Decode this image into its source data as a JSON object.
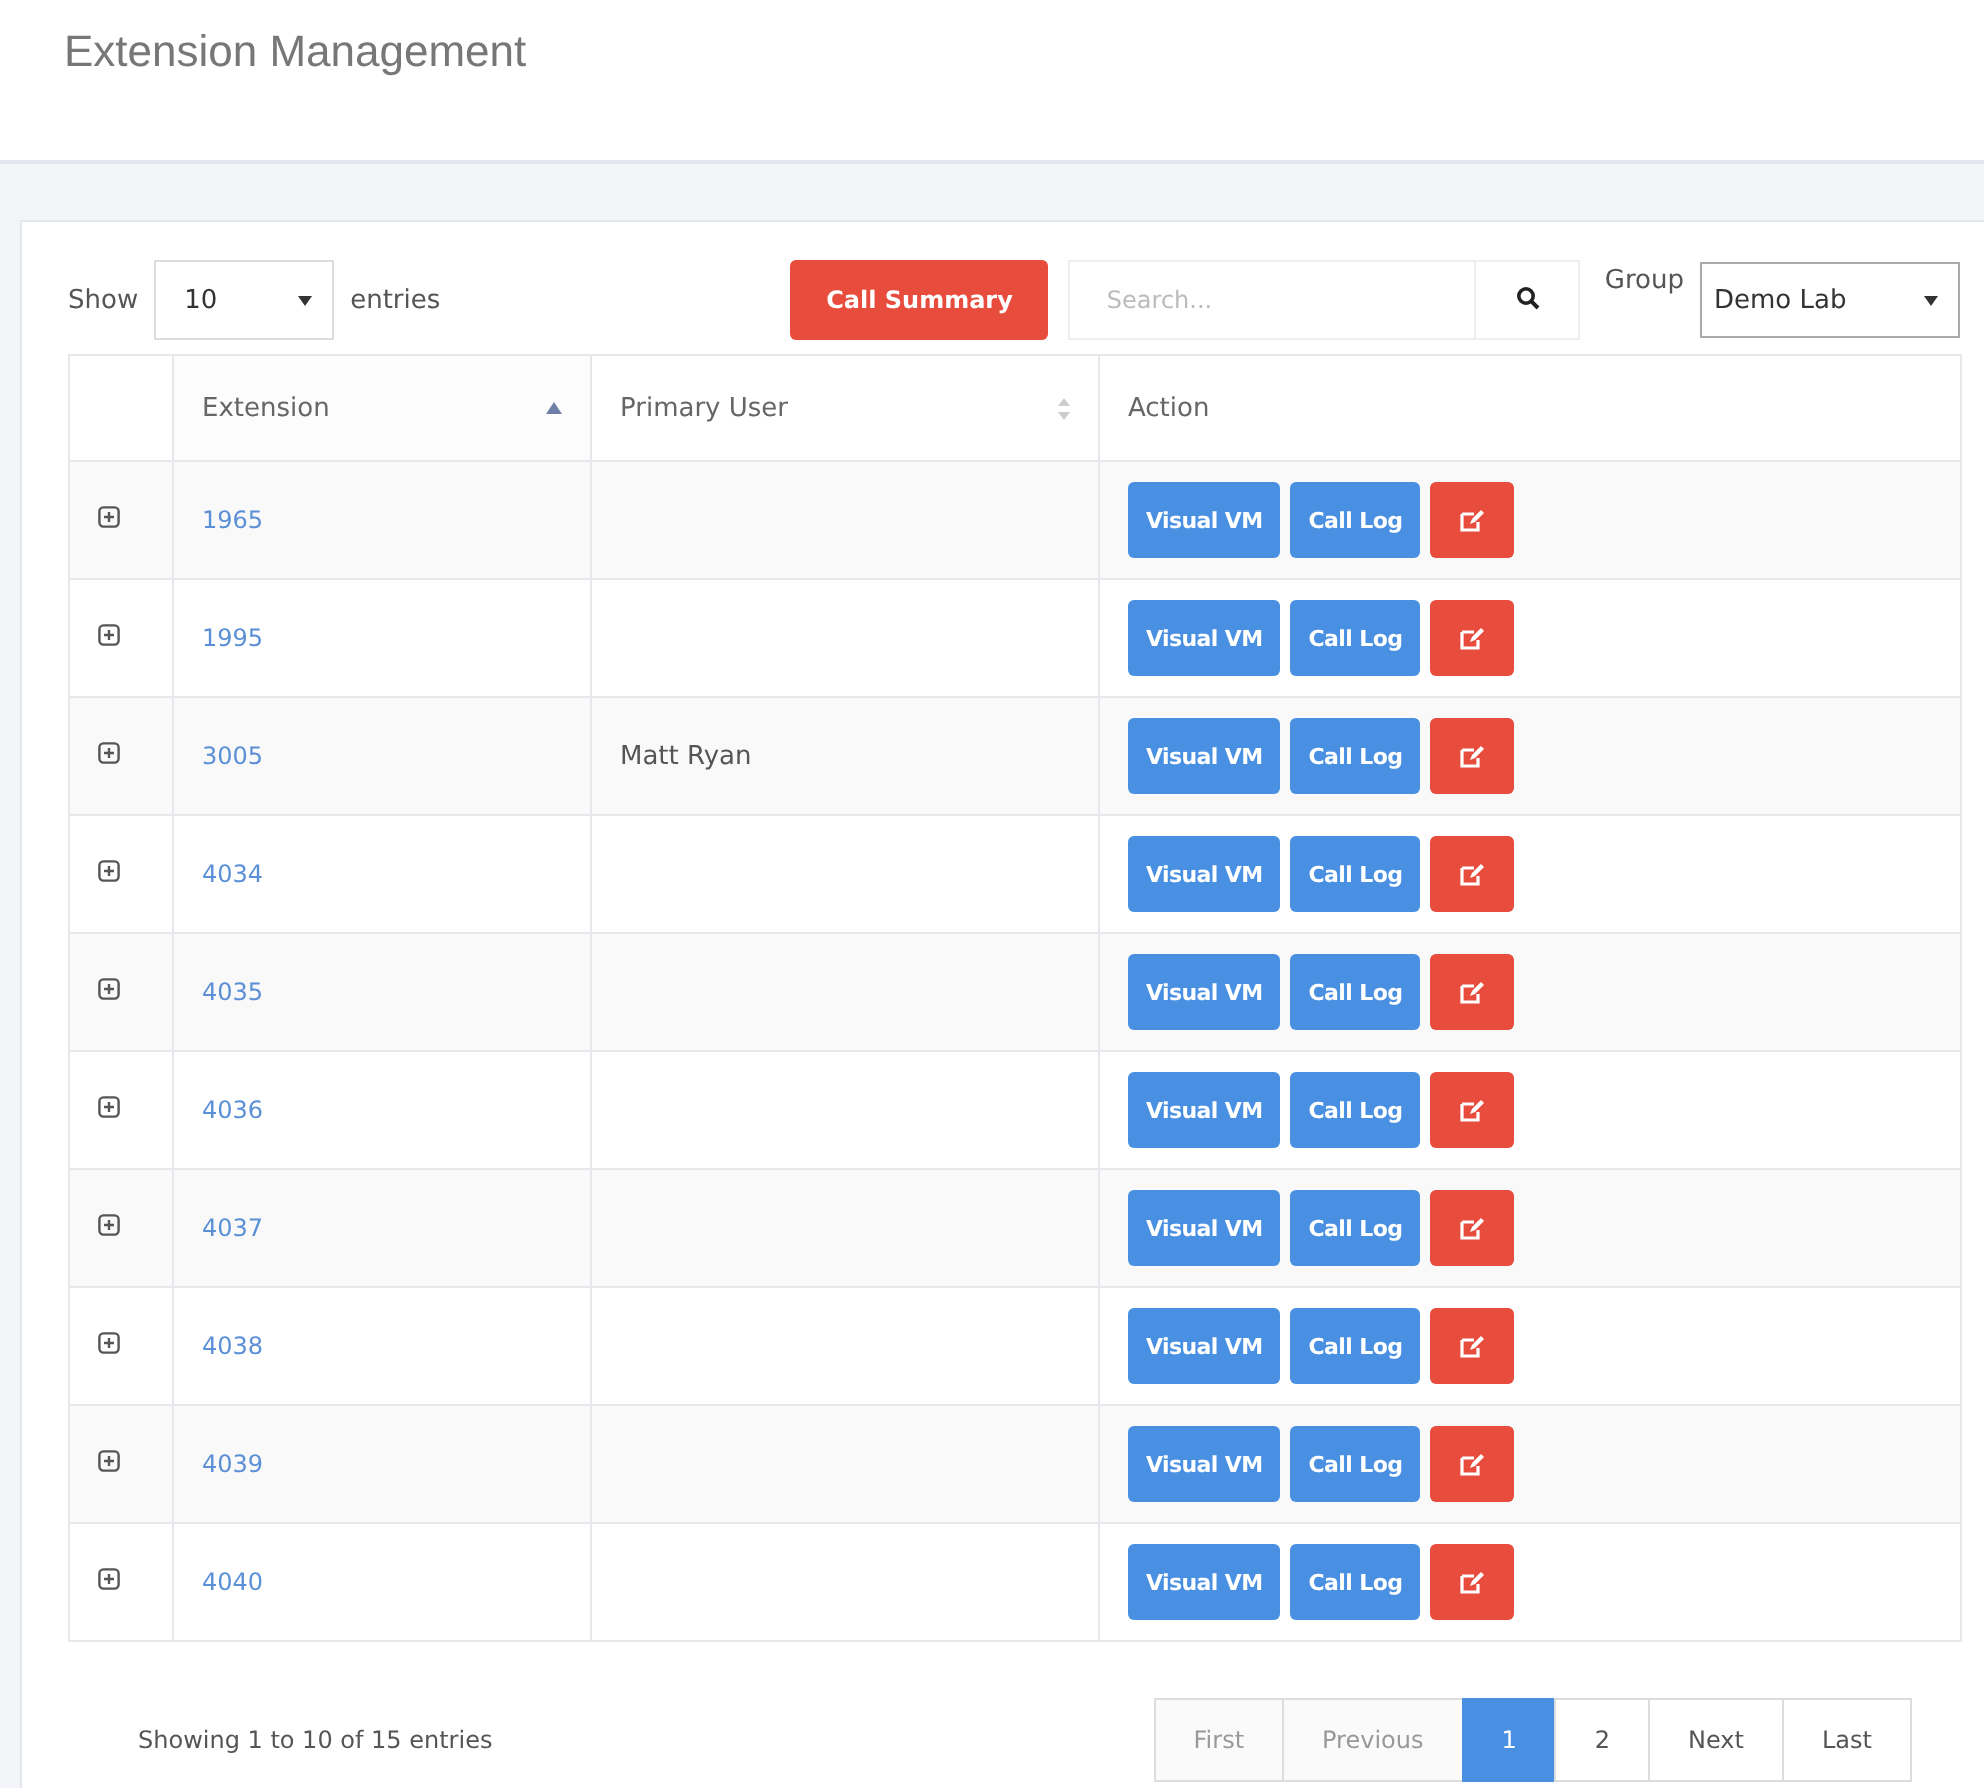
{
  "page": {
    "title": "Extension Management"
  },
  "toolbar": {
    "show_label": "Show",
    "page_size": "10",
    "entries_label": "entries",
    "summary_button": "Call Summary",
    "search": {
      "placeholder": "Search..."
    },
    "group_label": "Group",
    "group_value": "Demo Lab"
  },
  "table": {
    "columns": [
      {},
      {
        "label": "Extension",
        "sorted": true
      },
      {
        "label": "Primary User",
        "sorted": false
      },
      {
        "label": "Action"
      }
    ],
    "rows": [
      {
        "extension": "1965",
        "primary_user": "",
        "actions": [
          "Visual VM",
          "Call Log"
        ]
      },
      {
        "extension": "1995",
        "primary_user": "",
        "actions": [
          "Visual VM",
          "Call Log"
        ]
      },
      {
        "extension": "3005",
        "primary_user": "Matt Ryan",
        "actions": [
          "Visual VM",
          "Call Log"
        ]
      },
      {
        "extension": "4034",
        "primary_user": "",
        "actions": [
          "Visual VM",
          "Call Log"
        ]
      },
      {
        "extension": "4035",
        "primary_user": "",
        "actions": [
          "Visual VM",
          "Call Log"
        ]
      },
      {
        "extension": "4036",
        "primary_user": "",
        "actions": [
          "Visual VM",
          "Call Log"
        ]
      },
      {
        "extension": "4037",
        "primary_user": "",
        "actions": [
          "Visual VM",
          "Call Log"
        ]
      },
      {
        "extension": "4038",
        "primary_user": "",
        "actions": [
          "Visual VM",
          "Call Log"
        ]
      },
      {
        "extension": "4039",
        "primary_user": "",
        "actions": [
          "Visual VM",
          "Call Log"
        ]
      },
      {
        "extension": "4040",
        "primary_user": "",
        "actions": [
          "Visual VM",
          "Call Log"
        ]
      }
    ]
  },
  "footer": {
    "info": "Showing 1 to 10 of 15 entries",
    "pagination": [
      {
        "label": "First",
        "disabled": true,
        "selected": false
      },
      {
        "label": "Previous",
        "disabled": true,
        "selected": false
      },
      {
        "label": "1",
        "disabled": false,
        "selected": true
      },
      {
        "label": "2",
        "disabled": false,
        "selected": false
      },
      {
        "label": "Next",
        "disabled": false,
        "selected": false
      },
      {
        "label": "Last",
        "disabled": false,
        "selected": false
      }
    ]
  }
}
